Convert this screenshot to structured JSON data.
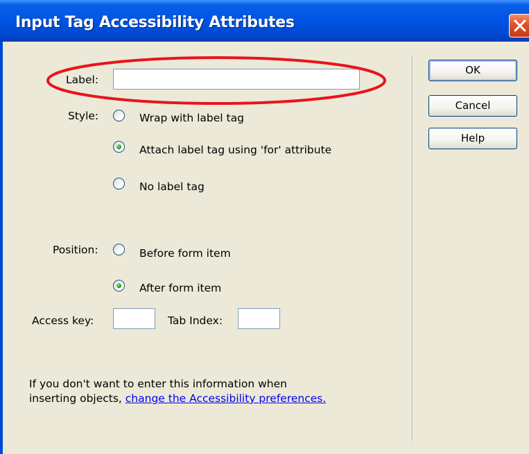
{
  "window": {
    "title": "Input Tag Accessibility Attributes"
  },
  "form": {
    "label_caption": "Label:",
    "label_value": "",
    "style_caption": "Style:",
    "style_options": [
      {
        "label": "Wrap with label tag",
        "selected": false
      },
      {
        "label": "Attach label tag using 'for' attribute",
        "selected": true
      },
      {
        "label": "No label tag",
        "selected": false
      }
    ],
    "position_caption": "Position:",
    "position_options": [
      {
        "label": "Before form item",
        "selected": false
      },
      {
        "label": "After form item",
        "selected": true
      }
    ],
    "access_key_caption": "Access key:",
    "access_key_value": "",
    "tab_index_caption": "Tab Index:",
    "tab_index_value": ""
  },
  "buttons": {
    "ok": "OK",
    "cancel": "Cancel",
    "help": "Help"
  },
  "footer": {
    "line1": "If you don't want to enter this information when",
    "line2_prefix": "inserting objects, ",
    "link": "change the Accessibility preferences."
  },
  "colors": {
    "titlebar": "#0054e3",
    "dialog_bg": "#ece9d8",
    "highlight_ellipse": "#e8141c",
    "radio_dot": "#21a121",
    "link": "#0000ee"
  },
  "icons": {
    "close": "close-icon"
  }
}
